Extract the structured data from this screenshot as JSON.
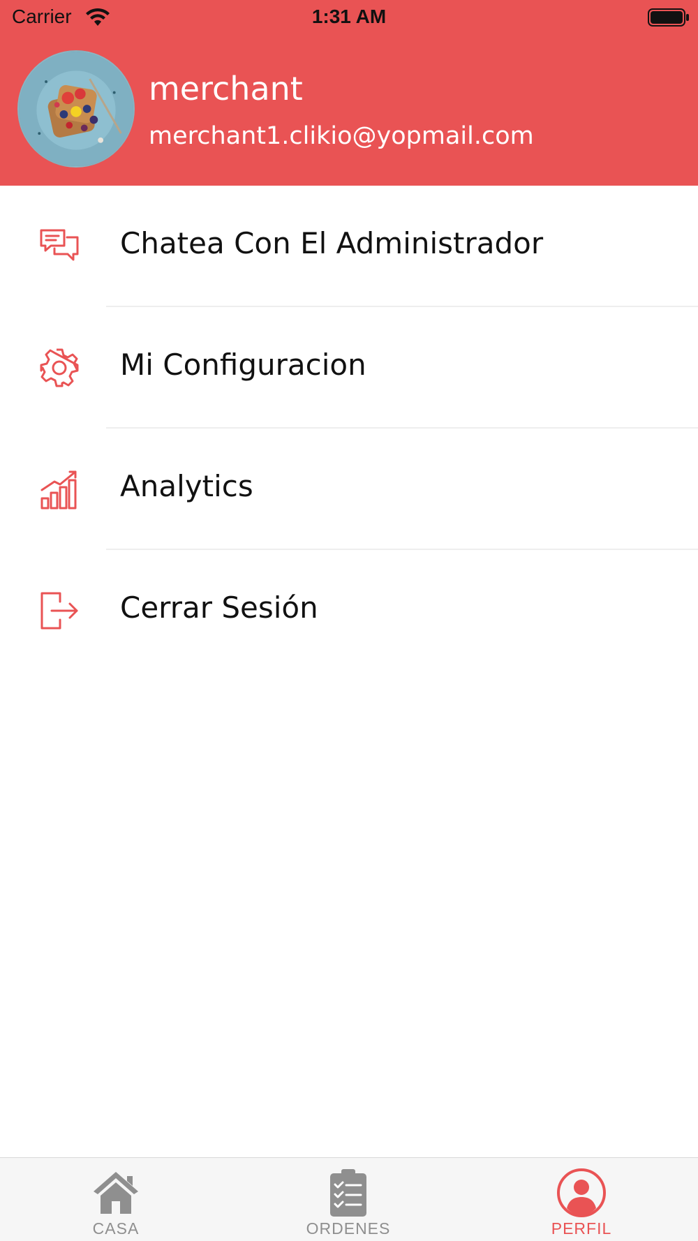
{
  "status_bar": {
    "carrier": "Carrier",
    "time": "1:31 AM"
  },
  "profile": {
    "name": "merchant",
    "email": "merchant1.clikio@yopmail.com"
  },
  "menu": {
    "items": [
      {
        "label": "Chatea Con El Administrador",
        "icon": "chat-icon"
      },
      {
        "label": "Mi Configuracion",
        "icon": "gear-icon"
      },
      {
        "label": "Analytics",
        "icon": "analytics-icon"
      },
      {
        "label": "Cerrar Sesión",
        "icon": "logout-icon"
      }
    ]
  },
  "tab_bar": {
    "tabs": [
      {
        "label": "CASA",
        "icon": "home-icon",
        "active": false
      },
      {
        "label": "ORDENES",
        "icon": "clipboard-icon",
        "active": false
      },
      {
        "label": "PERFIL",
        "icon": "user-icon",
        "active": true
      }
    ]
  },
  "colors": {
    "accent": "#e95354",
    "inactive": "#8f8f8f",
    "tab_background": "#f6f6f6"
  }
}
